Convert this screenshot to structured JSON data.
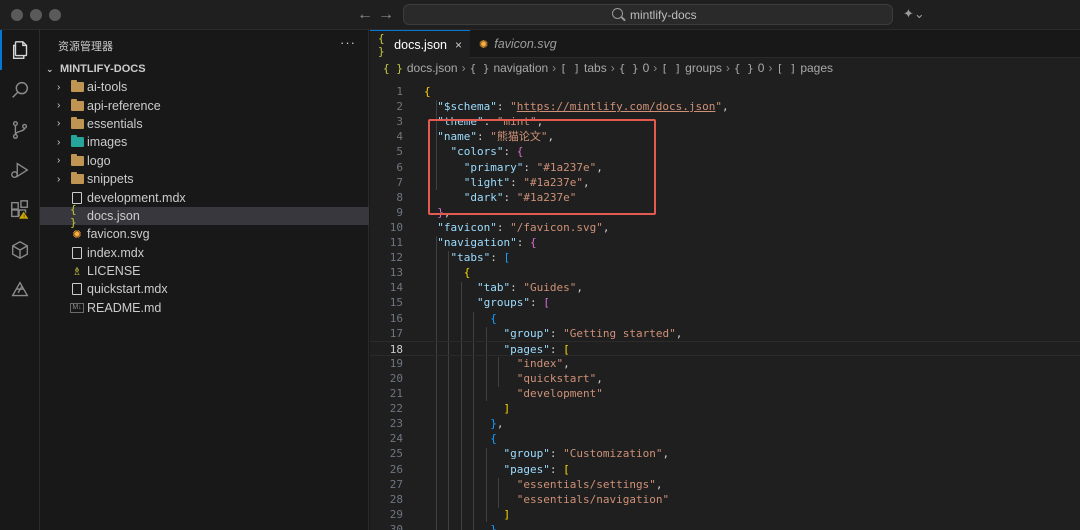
{
  "titlebar": {
    "search_text": "mintlify-docs",
    "back_arrow": "←",
    "forward_arrow": "→",
    "copilot_glyph": "✦⌄"
  },
  "activity_bar": {
    "items": [
      "explorer-icon",
      "search-icon",
      "source-control-icon",
      "run-debug-icon",
      "extensions-icon",
      "remote-icon",
      "copilot-icon"
    ],
    "accent": "#0078d4",
    "warning_color": "#cca700"
  },
  "sidebar": {
    "title": "资源管理器",
    "more": "···",
    "root_label": "MINTLIFY-DOCS",
    "items": [
      {
        "label": "ai-tools",
        "kind": "folder"
      },
      {
        "label": "api-reference",
        "kind": "folder"
      },
      {
        "label": "essentials",
        "kind": "folder"
      },
      {
        "label": "images",
        "kind": "folder-images"
      },
      {
        "label": "logo",
        "kind": "folder"
      },
      {
        "label": "snippets",
        "kind": "folder"
      },
      {
        "label": "development.mdx",
        "kind": "file"
      },
      {
        "label": "docs.json",
        "kind": "json",
        "selected": true
      },
      {
        "label": "favicon.svg",
        "kind": "svg"
      },
      {
        "label": "index.mdx",
        "kind": "file"
      },
      {
        "label": "LICENSE",
        "kind": "license"
      },
      {
        "label": "quickstart.mdx",
        "kind": "file"
      },
      {
        "label": "README.md",
        "kind": "markdown"
      }
    ]
  },
  "tabs": [
    {
      "label": "docs.json",
      "icon": "{ }",
      "active": true,
      "close": "×"
    },
    {
      "label": "favicon.svg",
      "icon": "✺",
      "active": false
    }
  ],
  "breadcrumb": [
    "docs.json",
    "navigation",
    "tabs",
    "0",
    "groups",
    "0",
    "pages"
  ],
  "breadcrumb_icons": [
    "{ }",
    "{ }",
    "[ ]",
    "{ }",
    "[ ]",
    "{ }",
    "[ ]"
  ],
  "editor": {
    "current_line": 18,
    "lines": [
      {
        "n": "1",
        "code": "{"
      },
      {
        "n": "2",
        "code": "  \"$schema\": \"https://mintlify.com/docs.json\","
      },
      {
        "n": "3",
        "code": "  \"theme\": \"mint\","
      },
      {
        "n": "4",
        "code": "  \"name\": \"熊猫论文\","
      },
      {
        "n": "5",
        "code": "    \"colors\": {"
      },
      {
        "n": "6",
        "code": "      \"primary\": \"#1a237e\","
      },
      {
        "n": "7",
        "code": "      \"light\": \"#1a237e\","
      },
      {
        "n": "8",
        "code": "      \"dark\": \"#1a237e\""
      },
      {
        "n": "9",
        "code": "  },"
      },
      {
        "n": "10",
        "code": "  \"favicon\": \"/favicon.svg\","
      },
      {
        "n": "11",
        "code": "  \"navigation\": {"
      },
      {
        "n": "12",
        "code": "    \"tabs\": ["
      },
      {
        "n": "13",
        "code": "      {"
      },
      {
        "n": "14",
        "code": "        \"tab\": \"Guides\","
      },
      {
        "n": "15",
        "code": "        \"groups\": ["
      },
      {
        "n": "16",
        "code": "          {"
      },
      {
        "n": "17",
        "code": "            \"group\": \"Getting started\","
      },
      {
        "n": "18",
        "code": "            \"pages\": ["
      },
      {
        "n": "19",
        "code": "              \"index\","
      },
      {
        "n": "20",
        "code": "              \"quickstart\","
      },
      {
        "n": "21",
        "code": "              \"development\""
      },
      {
        "n": "22",
        "code": "            ]"
      },
      {
        "n": "23",
        "code": "          },"
      },
      {
        "n": "24",
        "code": "          {"
      },
      {
        "n": "25",
        "code": "            \"group\": \"Customization\","
      },
      {
        "n": "26",
        "code": "            \"pages\": ["
      },
      {
        "n": "27",
        "code": "              \"essentials/settings\","
      },
      {
        "n": "28",
        "code": "              \"essentials/navigation\""
      },
      {
        "n": "29",
        "code": "            ]"
      },
      {
        "n": "30",
        "code": "          },"
      }
    ]
  },
  "colors": {
    "annotation_box": "#e25a50",
    "key": "#9cdcfe",
    "string": "#ce9178",
    "bracket_gold": "#ffd700",
    "bracket_purple": "#da70d6",
    "bracket_blue": "#179fff"
  }
}
